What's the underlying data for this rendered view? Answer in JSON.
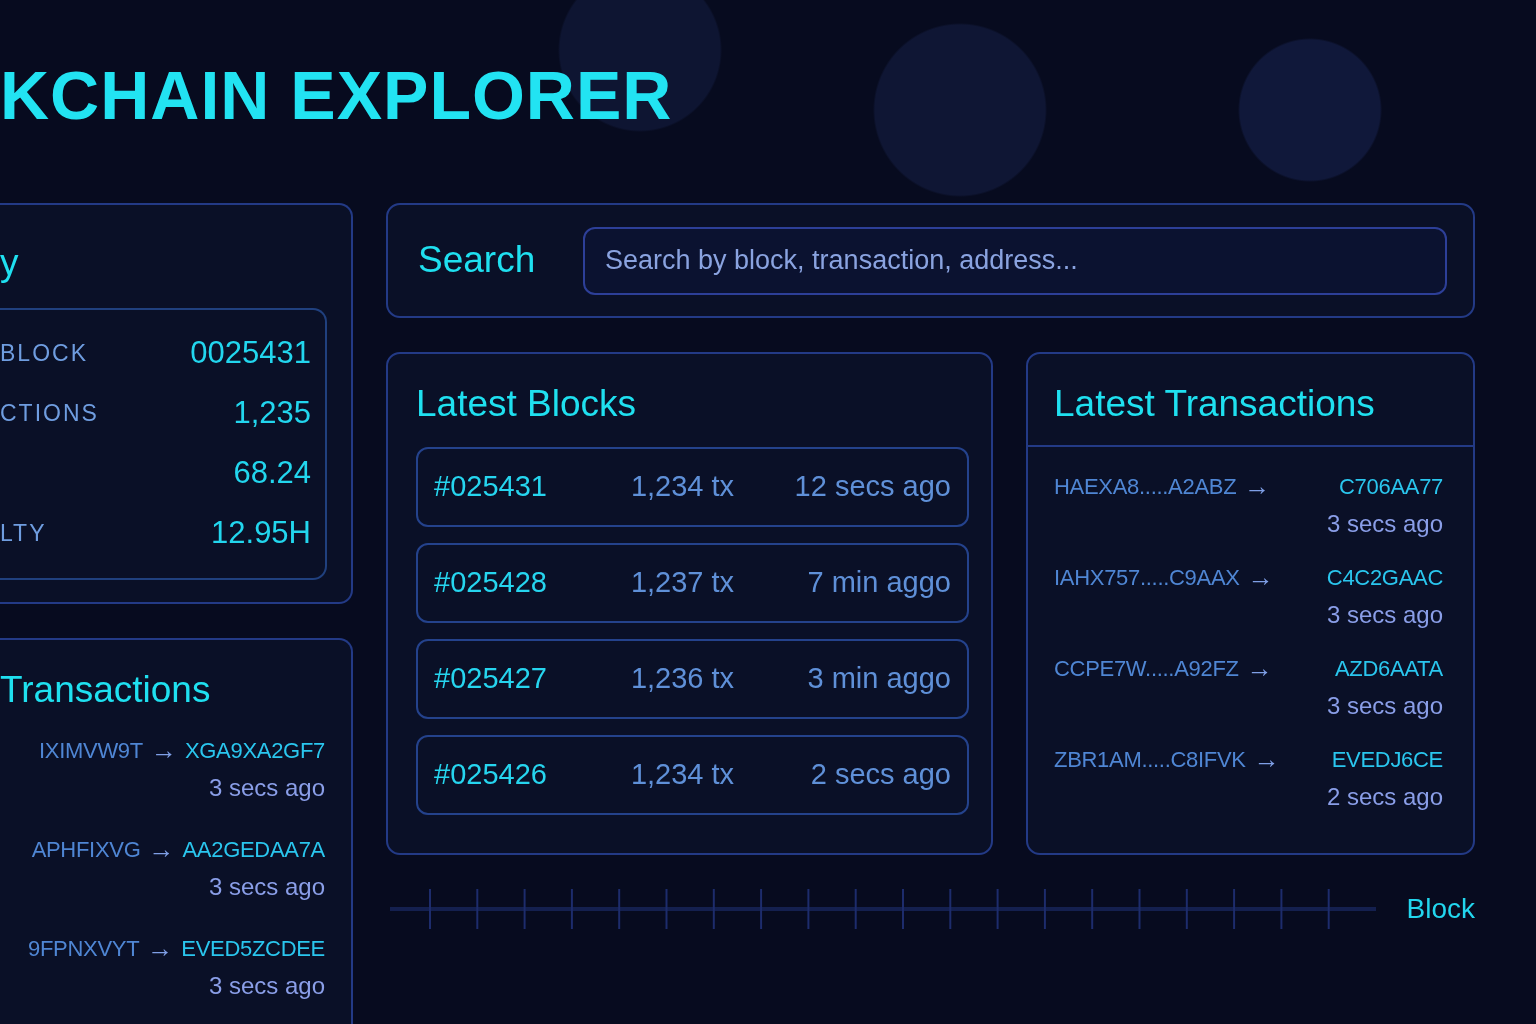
{
  "header": {
    "title": "KCHAIN EXPLORER"
  },
  "summary": {
    "title": "y",
    "stats": [
      {
        "label": "BLOCK",
        "value": "0025431"
      },
      {
        "label": "CTIONS",
        "value": "1,235"
      },
      {
        "value": "68.24"
      },
      {
        "label": "LTY",
        "value": "12.95H"
      }
    ]
  },
  "side_transactions": {
    "title": "Transactions",
    "items": [
      {
        "from": "IXIMVW9T",
        "arrow": "→",
        "to": "XGA9XA2GF7",
        "time": "3 secs ago"
      },
      {
        "from": "APHFIXVG",
        "arrow": "→",
        "to": "AA2GEDAA7A",
        "time": "3 secs ago"
      },
      {
        "from": "9FPNXVYT",
        "arrow": "→",
        "to": "EVED5ZCDEE",
        "time": "3 secs ago"
      }
    ]
  },
  "search": {
    "label": "Search",
    "placeholder": "Search by block, transaction, address..."
  },
  "latest_blocks": {
    "title": "Latest Blocks",
    "rows": [
      {
        "block": "#025431",
        "tx": "1,234 tx",
        "time": "12 secs ago"
      },
      {
        "block": "#025428",
        "tx": "1,237 tx",
        "time": "7 min aggo"
      },
      {
        "block": "#025427",
        "tx": "1,236 tx",
        "time": "3 min aggo"
      },
      {
        "block": "#025426",
        "tx": "1,234 tx",
        "time": "2 secs ago"
      }
    ]
  },
  "latest_transactions": {
    "title": "Latest Transactions",
    "items": [
      {
        "from": "HAEXA8.....A2ABZ",
        "arrow": "→",
        "to": "C706AA77",
        "time": "3 secs ago"
      },
      {
        "from": "IAHX757.....C9AAX",
        "arrow": "→",
        "to": "C4C2GAAC",
        "time": "3 secs ago"
      },
      {
        "from": "CCPE7W.....A92FZ",
        "arrow": "→",
        "to": "AZD6AATA",
        "time": "3 secs ago"
      },
      {
        "from": "ZBR1AM.....C8IFVK",
        "arrow": "→",
        "to": "EVEDJ6CE",
        "time": "2 secs ago"
      }
    ]
  },
  "timeline": {
    "label": "Block"
  }
}
